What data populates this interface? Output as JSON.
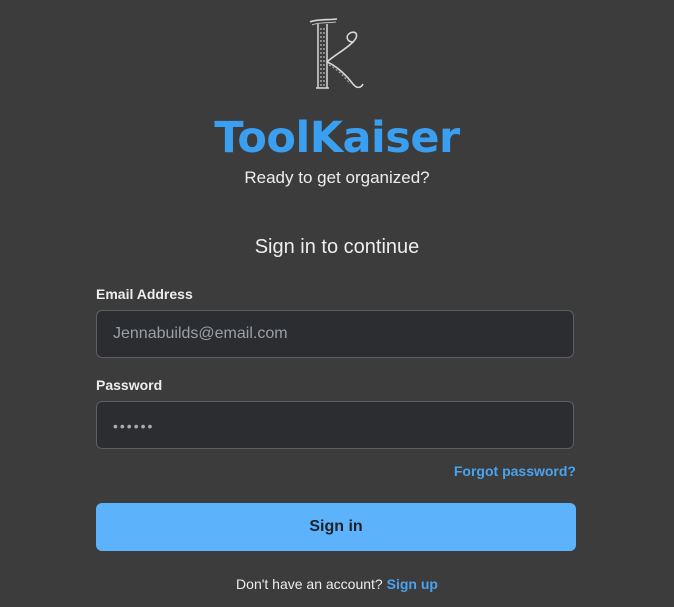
{
  "brand": {
    "name": "ToolKaiser",
    "tagline": "Ready to get organized?",
    "logo_icon": "k-monogram-icon",
    "accent_color": "#3a9ff0"
  },
  "form": {
    "heading": "Sign in to continue",
    "email": {
      "label": "Email Address",
      "placeholder": "Jennabuilds@email.com",
      "value": ""
    },
    "password": {
      "label": "Password",
      "masked_value": "••••••"
    },
    "forgot_link": "Forgot password?",
    "submit_label": "Sign in",
    "button_color": "#5cb3fb"
  },
  "footer": {
    "prompt": "Don't have an account?",
    "signup_link": "Sign up",
    "link_color": "#4aa3ee"
  }
}
